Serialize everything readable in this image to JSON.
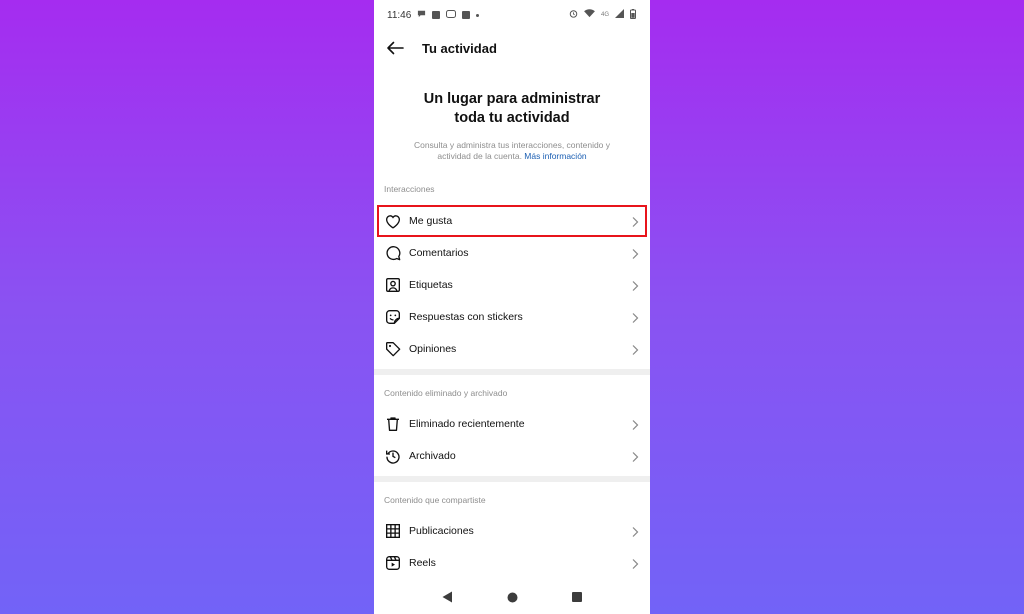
{
  "status_bar": {
    "time": "11:46",
    "network": "4G"
  },
  "app_bar": {
    "title": "Tu actividad"
  },
  "hero": {
    "title_line1": "Un lugar para administrar",
    "title_line2": "toda tu actividad",
    "description": "Consulta y administra tus interacciones, contenido y actividad de la cuenta. ",
    "link": "Más información"
  },
  "sections": [
    {
      "label": "Interacciones",
      "items": [
        {
          "label": "Me gusta",
          "icon": "heart-icon",
          "highlighted": true
        },
        {
          "label": "Comentarios",
          "icon": "comment-icon"
        },
        {
          "label": "Etiquetas",
          "icon": "tag-user-icon"
        },
        {
          "label": "Respuestas con stickers",
          "icon": "sticker-icon"
        },
        {
          "label": "Opiniones",
          "icon": "price-tag-icon"
        }
      ]
    },
    {
      "label": "Contenido eliminado y archivado",
      "items": [
        {
          "label": "Eliminado recientemente",
          "icon": "trash-icon"
        },
        {
          "label": "Archivado",
          "icon": "archive-history-icon"
        }
      ]
    },
    {
      "label": "Contenido que compartiste",
      "items": [
        {
          "label": "Publicaciones",
          "icon": "grid-icon"
        },
        {
          "label": "Reels",
          "icon": "reels-icon"
        }
      ]
    }
  ],
  "colors": {
    "highlight": "#e8141b",
    "link": "#1b5fb3",
    "background_top": "#a52cf0",
    "background_bottom": "#7263f7"
  }
}
